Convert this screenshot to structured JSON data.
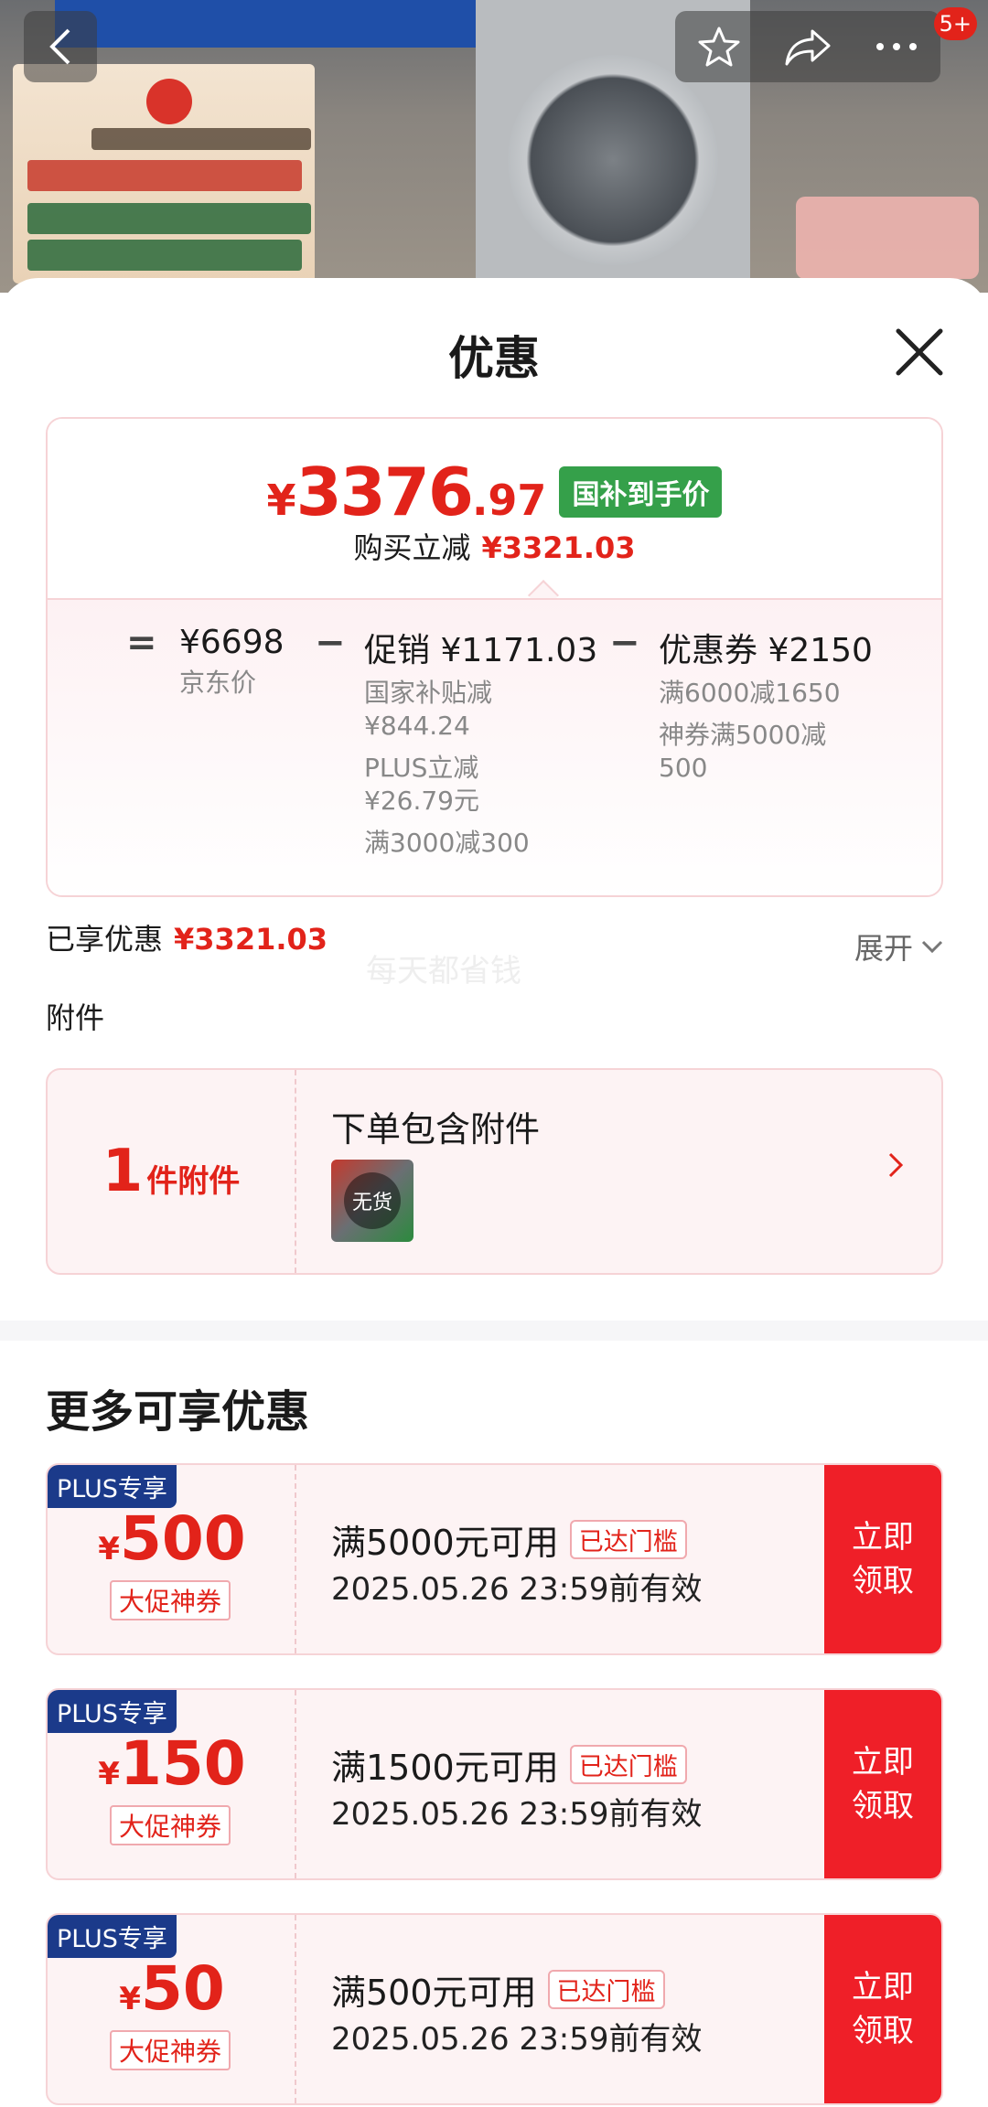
{
  "top_bar": {
    "message_count": "5+"
  },
  "sheet": {
    "title": "优惠"
  },
  "price": {
    "yen": "¥",
    "integer": "3376",
    "decimal": ".97",
    "tag": "国补到手价",
    "reduce_label": "购买立减",
    "reduce_value": "¥3321.03"
  },
  "breakdown": {
    "equals": "=",
    "minus": "−",
    "jd_price": "¥6698",
    "jd_label": "京东价",
    "promo_main": "促销 ¥1171.03",
    "promo_items": [
      "国家补贴减",
      "¥844.24",
      "PLUS立减",
      "¥26.79元",
      "满3000减300"
    ],
    "coupon_main": "优惠券 ¥2150",
    "coupon_items": [
      "满6000减1650",
      "神券满5000减",
      "500"
    ]
  },
  "enjoyed": {
    "label": "已享优惠",
    "value": "¥3321.03",
    "expand": "展开"
  },
  "watermark": "每天都省钱",
  "attachments": {
    "section_label": "附件",
    "count": "1",
    "unit": "件附件",
    "title": "下单包含附件",
    "thumb_status": "无货"
  },
  "more_offers": {
    "title": "更多可享优惠",
    "coupons": [
      {
        "tag": "PLUS专享",
        "yen": "¥",
        "amount": "500",
        "type": "大促神券",
        "condition": "满5000元可用",
        "badge": "已达门槛",
        "expiry": "2025.05.26 23:59前有效",
        "btn": "立即\n领取"
      },
      {
        "tag": "PLUS专享",
        "yen": "¥",
        "amount": "150",
        "type": "大促神券",
        "condition": "满1500元可用",
        "badge": "已达门槛",
        "expiry": "2025.05.26 23:59前有效",
        "btn": "立即\n领取"
      },
      {
        "tag": "PLUS专享",
        "yen": "¥",
        "amount": "50",
        "type": "大促神券",
        "condition": "满500元可用",
        "badge": "已达门槛",
        "expiry": "2025.05.26 23:59前有效",
        "btn": "立即\n领取"
      }
    ]
  },
  "colors": {
    "accent_red": "#e2231a",
    "green_tag": "#35a04a",
    "plus_blue": "#1b3a8a",
    "button_red": "#ef1f28"
  }
}
